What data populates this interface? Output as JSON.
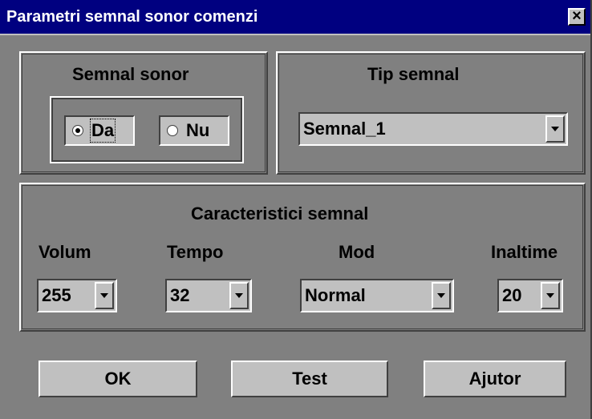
{
  "window": {
    "title": "Parametri semnal sonor comenzi",
    "close_label": "×"
  },
  "signal_group": {
    "title": "Semnal sonor",
    "options": [
      {
        "label": "Da",
        "selected": true
      },
      {
        "label": "Nu",
        "selected": false
      }
    ]
  },
  "type_group": {
    "title": "Tip semnal",
    "value": "Semnal_1"
  },
  "characteristics": {
    "title": "Caracteristici semnal",
    "volume": {
      "label": "Volum",
      "value": "255"
    },
    "tempo": {
      "label": "Tempo",
      "value": "32"
    },
    "mode": {
      "label": "Mod",
      "value": "Normal"
    },
    "pitch": {
      "label": "Inaltime",
      "value": "20"
    }
  },
  "buttons": {
    "ok": "OK",
    "test": "Test",
    "help": "Ajutor"
  }
}
